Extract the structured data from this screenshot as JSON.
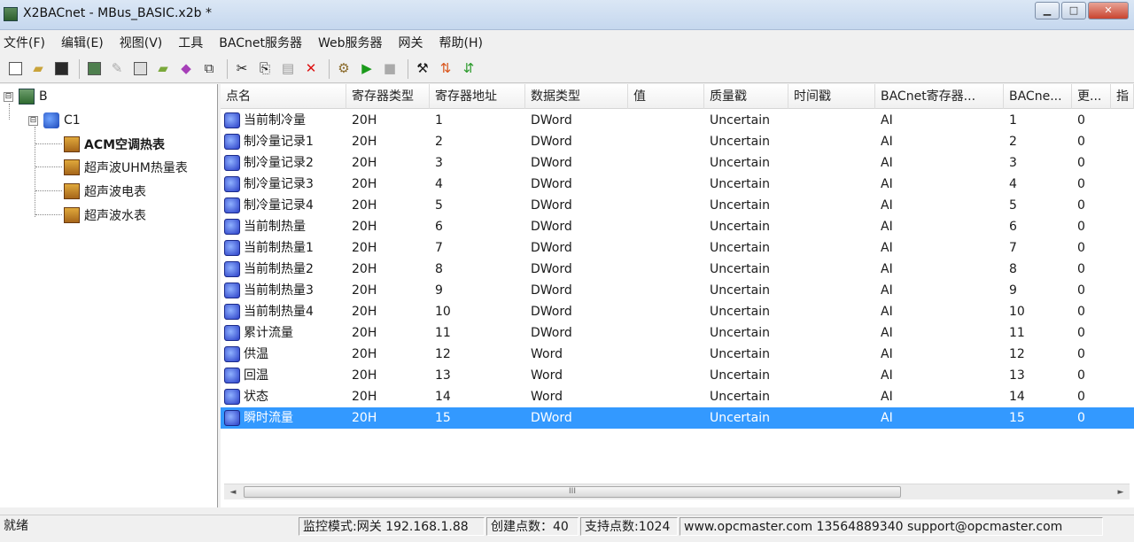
{
  "window": {
    "title": "X2BACnet - MBus_BASIC.x2b *",
    "min_icon": "minimize-icon",
    "max_icon": "maximize-icon",
    "close_icon": "close-icon"
  },
  "menu": [
    "文件(F)",
    "编辑(E)",
    "视图(V)",
    "工具",
    "BACnet服务器",
    "Web服务器",
    "网关",
    "帮助(H)"
  ],
  "toolbar": [
    "new-icon",
    "open-icon",
    "save-icon",
    "device-icon",
    "pin-icon",
    "doc-icon",
    "folder-icon",
    "cube-icon",
    "export-icon",
    "cut-icon",
    "copy-icon",
    "paste-icon",
    "delete-icon",
    "tool-icon",
    "play-icon",
    "stop-icon",
    "hammer-icon",
    "transfer-icon",
    "sync-icon"
  ],
  "tree": {
    "root": {
      "label": "B",
      "toggle": "⊟"
    },
    "child": {
      "label": "C1",
      "toggle": "⊟"
    },
    "leaves": [
      "ACM空调热表",
      "超声波UHM热量表",
      "超声波电表",
      "超声波水表"
    ]
  },
  "grid": {
    "columns": [
      "点名",
      "寄存器类型",
      "寄存器地址",
      "数据类型",
      "值",
      "质量戳",
      "时间戳",
      "BACnet寄存器...",
      "BACne...",
      "更...",
      "指"
    ],
    "rows": [
      [
        "当前制冷量",
        "20H",
        "1",
        "DWord",
        "",
        "Uncertain",
        "",
        "AI",
        "1",
        "0"
      ],
      [
        "制冷量记录1",
        "20H",
        "2",
        "DWord",
        "",
        "Uncertain",
        "",
        "AI",
        "2",
        "0"
      ],
      [
        "制冷量记录2",
        "20H",
        "3",
        "DWord",
        "",
        "Uncertain",
        "",
        "AI",
        "3",
        "0"
      ],
      [
        "制冷量记录3",
        "20H",
        "4",
        "DWord",
        "",
        "Uncertain",
        "",
        "AI",
        "4",
        "0"
      ],
      [
        "制冷量记录4",
        "20H",
        "5",
        "DWord",
        "",
        "Uncertain",
        "",
        "AI",
        "5",
        "0"
      ],
      [
        "当前制热量",
        "20H",
        "6",
        "DWord",
        "",
        "Uncertain",
        "",
        "AI",
        "6",
        "0"
      ],
      [
        "当前制热量1",
        "20H",
        "7",
        "DWord",
        "",
        "Uncertain",
        "",
        "AI",
        "7",
        "0"
      ],
      [
        "当前制热量2",
        "20H",
        "8",
        "DWord",
        "",
        "Uncertain",
        "",
        "AI",
        "8",
        "0"
      ],
      [
        "当前制热量3",
        "20H",
        "9",
        "DWord",
        "",
        "Uncertain",
        "",
        "AI",
        "9",
        "0"
      ],
      [
        "当前制热量4",
        "20H",
        "10",
        "DWord",
        "",
        "Uncertain",
        "",
        "AI",
        "10",
        "0"
      ],
      [
        "累计流量",
        "20H",
        "11",
        "DWord",
        "",
        "Uncertain",
        "",
        "AI",
        "11",
        "0"
      ],
      [
        "供温",
        "20H",
        "12",
        "Word",
        "",
        "Uncertain",
        "",
        "AI",
        "12",
        "0"
      ],
      [
        "回温",
        "20H",
        "13",
        "Word",
        "",
        "Uncertain",
        "",
        "AI",
        "13",
        "0"
      ],
      [
        "状态",
        "20H",
        "14",
        "Word",
        "",
        "Uncertain",
        "",
        "AI",
        "14",
        "0"
      ],
      [
        "瞬时流量",
        "20H",
        "15",
        "DWord",
        "",
        "Uncertain",
        "",
        "AI",
        "15",
        "0"
      ]
    ],
    "selected_row": 14,
    "scroll_thumb_label": "III"
  },
  "status": {
    "ready": "就绪",
    "mode": "监控模式:网关 192.168.1.88",
    "created": "创建点数：40",
    "supported": "支持点数:1024",
    "contact": "www.opcmaster.com 13564889340 support@opcmaster.com"
  },
  "colors": {
    "selection": "#3399ff",
    "row_icon": "#2a3fc7"
  }
}
